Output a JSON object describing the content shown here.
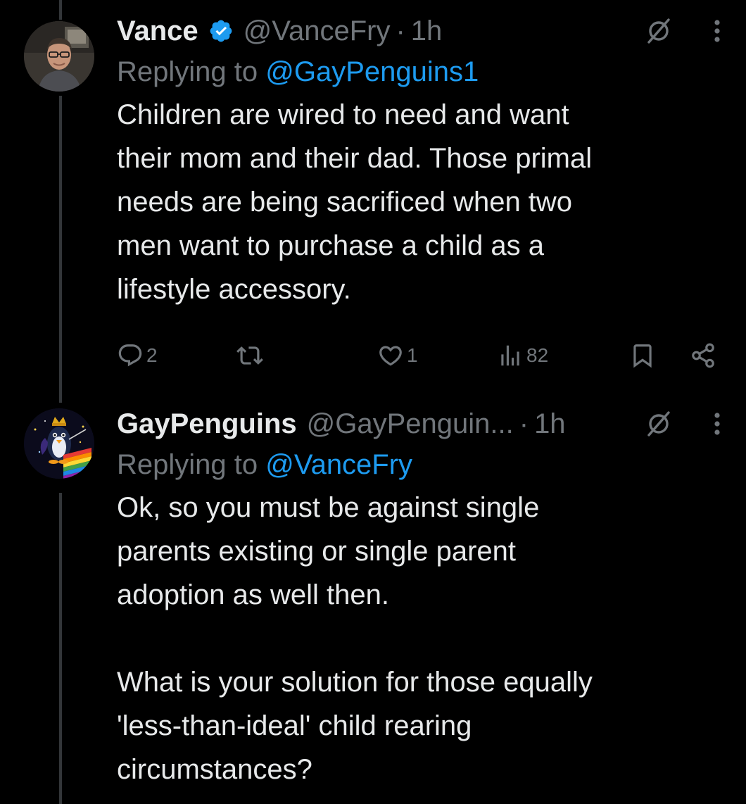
{
  "thread": [
    {
      "author": {
        "display_name": "Vance",
        "verified": true,
        "handle": "@VanceFry",
        "separator": "·",
        "time": "1h"
      },
      "replying_prefix": "Replying to",
      "replying_to": "@GayPenguins1",
      "text": "Children are wired to need and want\ntheir mom and their dad. Those primal\nneeds are being sacrificed when two\nmen want to purchase a child as a\nlifestyle accessory.",
      "stats": {
        "replies": "2",
        "reposts": "",
        "likes": "1",
        "views": "82"
      }
    },
    {
      "author": {
        "display_name": "GayPenguins",
        "verified": false,
        "handle": "@GayPenguin...",
        "separator": "·",
        "time": "1h"
      },
      "replying_prefix": "Replying to",
      "replying_to": "@VanceFry",
      "text": "Ok, so you must be against single\nparents existing or single parent\nadoption as well then.\n\nWhat is your solution for those equally\n'less-than-ideal' child rearing\ncircumstances?"
    }
  ],
  "colors": {
    "background": "#000000",
    "primary_text": "#e7e9ea",
    "secondary_text": "#71767b",
    "link": "#1d9bf0",
    "verified_badge": "#1d9bf0",
    "thread_line": "#333639"
  },
  "icons": {
    "verified": "verified-badge-icon",
    "grok": "grok-icon",
    "more": "more-options-icon",
    "reply": "reply-icon",
    "repost": "repost-icon",
    "like": "like-icon",
    "views": "views-icon",
    "bookmark": "bookmark-icon",
    "share": "share-icon"
  }
}
